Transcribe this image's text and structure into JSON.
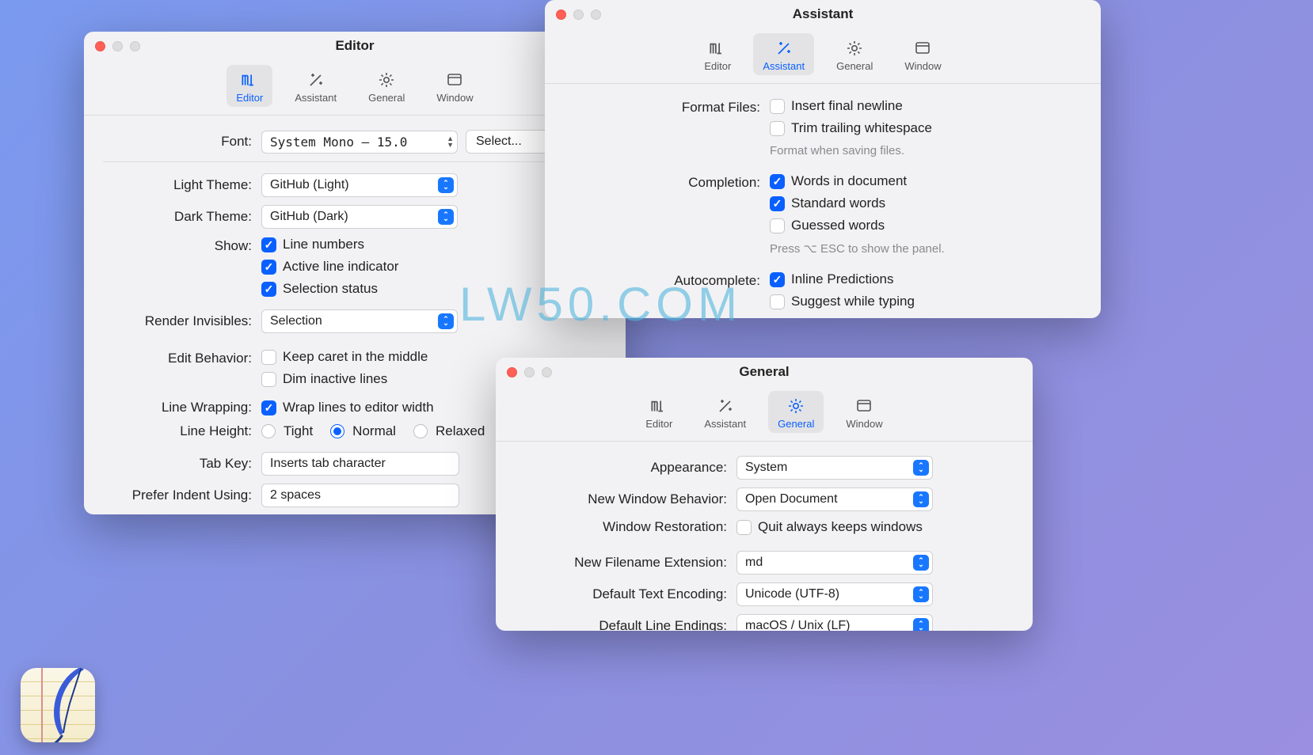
{
  "watermark": "LW50.COM",
  "tabs": {
    "editor": "Editor",
    "assistant": "Assistant",
    "general": "General",
    "window": "Window"
  },
  "editor": {
    "title": "Editor",
    "font_label": "Font:",
    "font_value": "System Mono — 15.0",
    "select_button": "Select...",
    "light_theme_label": "Light Theme:",
    "light_theme_value": "GitHub (Light)",
    "dark_theme_label": "Dark Theme:",
    "dark_theme_value": "GitHub (Dark)",
    "show_label": "Show:",
    "show_line_numbers": "Line numbers",
    "show_active_line": "Active line indicator",
    "show_selection_status": "Selection status",
    "render_invisibles_label": "Render Invisibles:",
    "render_invisibles_value": "Selection",
    "edit_behavior_label": "Edit Behavior:",
    "keep_caret": "Keep caret in the middle",
    "dim_inactive": "Dim inactive lines",
    "line_wrapping_label": "Line Wrapping:",
    "wrap_lines": "Wrap lines to editor width",
    "line_height_label": "Line Height:",
    "lh_tight": "Tight",
    "lh_normal": "Normal",
    "lh_relaxed": "Relaxed",
    "tab_key_label": "Tab Key:",
    "tab_key_value": "Inserts tab character",
    "prefer_indent_label": "Prefer Indent Using:",
    "prefer_indent_value": "2 spaces"
  },
  "assistant": {
    "title": "Assistant",
    "format_files_label": "Format Files:",
    "insert_final_newline": "Insert final newline",
    "trim_trailing": "Trim trailing whitespace",
    "format_hint": "Format when saving files.",
    "completion_label": "Completion:",
    "words_in_doc": "Words in document",
    "standard_words": "Standard words",
    "guessed_words": "Guessed words",
    "completion_hint": "Press ⌥ ESC to show the panel.",
    "autocomplete_label": "Autocomplete:",
    "inline_predictions": "Inline Predictions",
    "suggest_typing": "Suggest while typing"
  },
  "general": {
    "title": "General",
    "appearance_label": "Appearance:",
    "appearance_value": "System",
    "new_window_label": "New Window Behavior:",
    "new_window_value": "Open Document",
    "window_restoration_label": "Window Restoration:",
    "quit_keeps": "Quit always keeps windows",
    "new_ext_label": "New Filename Extension:",
    "new_ext_value": "md",
    "encoding_label": "Default Text Encoding:",
    "encoding_value": "Unicode (UTF-8)",
    "line_endings_label": "Default Line Endings:",
    "line_endings_value": "macOS / Unix (LF)"
  }
}
